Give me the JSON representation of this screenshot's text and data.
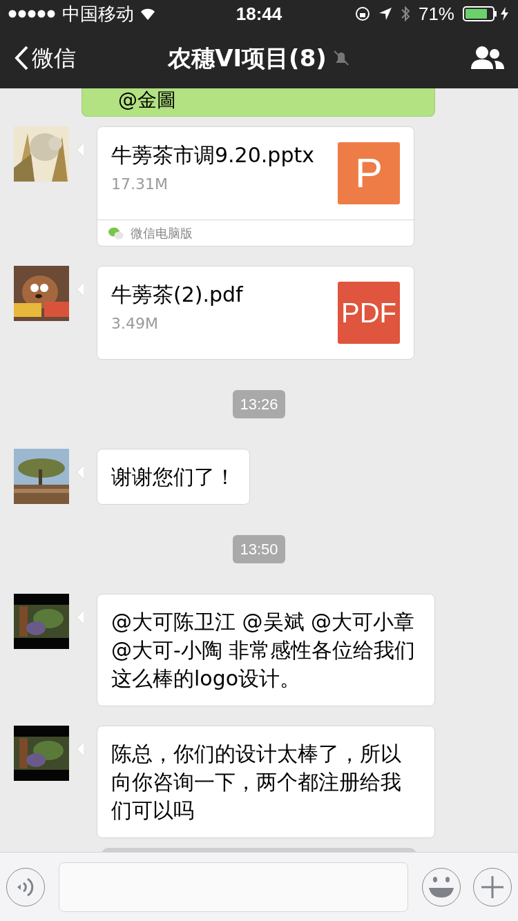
{
  "status_bar": {
    "carrier": "中国移动",
    "time": "18:44",
    "battery": "71%"
  },
  "nav": {
    "back": "微信",
    "title": "农穗VI项目(8)",
    "muted": true
  },
  "messages": [
    {
      "kind": "sent",
      "text": "@金圖"
    },
    {
      "kind": "file",
      "name": "牛蒡茶市调9.20.pptx",
      "size": "17.31M",
      "color": "#ee7c47",
      "source": "微信电脑版",
      "icon_label": "P"
    },
    {
      "kind": "file",
      "name": "牛蒡茶(2).pdf",
      "size": "3.49M",
      "color": "#df553e",
      "icon_label": "PDF"
    },
    {
      "kind": "time",
      "text": "13:26"
    },
    {
      "kind": "text",
      "text": "谢谢您们了！"
    },
    {
      "kind": "time",
      "text": "13:50"
    },
    {
      "kind": "text",
      "text": "@大可陈卫江 @吴斌 @大可小章 @大可-小陶 非常感性各位给我们这么棒的logo设计。"
    },
    {
      "kind": "text",
      "text": "陈总，你们的设计太棒了，所以向你咨询一下，两个都注册给我们可以吗"
    }
  ]
}
